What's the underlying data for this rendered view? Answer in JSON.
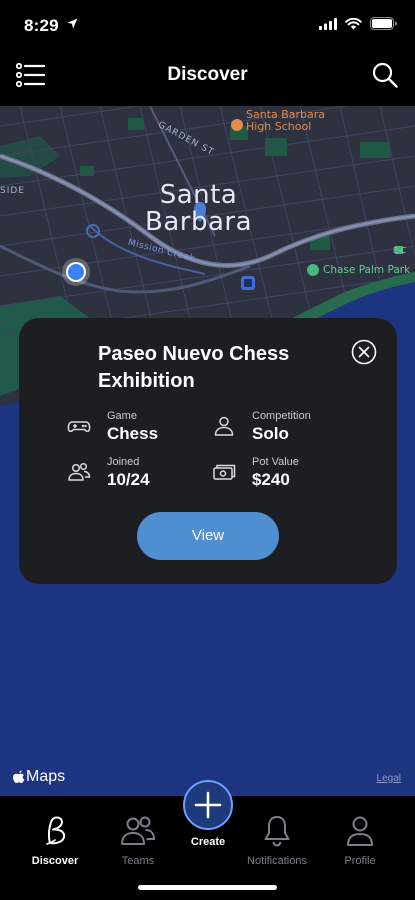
{
  "status_bar": {
    "time": "8:29",
    "icons": [
      "location-arrow-icon",
      "cellular-signal-icon",
      "wifi-icon",
      "battery-icon"
    ]
  },
  "nav": {
    "title": "Discover",
    "left_icon": "menu-list-icon",
    "right_icon": "search-icon"
  },
  "map": {
    "city_line1": "Santa",
    "city_line2": "Barbara",
    "school_line1": "Santa Barbara",
    "school_line2": "High School",
    "park": "Chase Palm Park",
    "street_garden": "GARDEN ST",
    "street_side": "SIDE",
    "creek": "Mission Creek",
    "edge_label": "E C",
    "brand": "Maps",
    "legal": "Legal",
    "colors": {
      "water": "#1d3580",
      "land": "#2d3140",
      "park": "#1f5a45",
      "road": "#5f6b86",
      "user_location": "#3b82f6"
    }
  },
  "card": {
    "title": "Paseo Nuevo Chess Exhibition",
    "close_icon": "close-circle-icon",
    "stats": [
      {
        "label": "Game",
        "value": "Chess",
        "icon": "gamepad-icon"
      },
      {
        "label": "Competition",
        "value": "Solo",
        "icon": "person-icon"
      },
      {
        "label": "Joined",
        "value": "10/24",
        "icon": "people-icon"
      },
      {
        "label": "Pot Value",
        "value": "$240",
        "icon": "cash-icon"
      }
    ],
    "button": "View",
    "colors": {
      "background": "#1d1e22",
      "button": "#4f8ed1"
    }
  },
  "tabs": [
    {
      "label": "Discover",
      "icon": "brand-b-icon",
      "active": true
    },
    {
      "label": "Teams",
      "icon": "people-icon",
      "active": false
    },
    {
      "label": "Create",
      "icon": "plus-icon",
      "active": false
    },
    {
      "label": "Notifications",
      "icon": "bell-icon",
      "active": false
    },
    {
      "label": "Profile",
      "icon": "person-icon",
      "active": false
    }
  ]
}
